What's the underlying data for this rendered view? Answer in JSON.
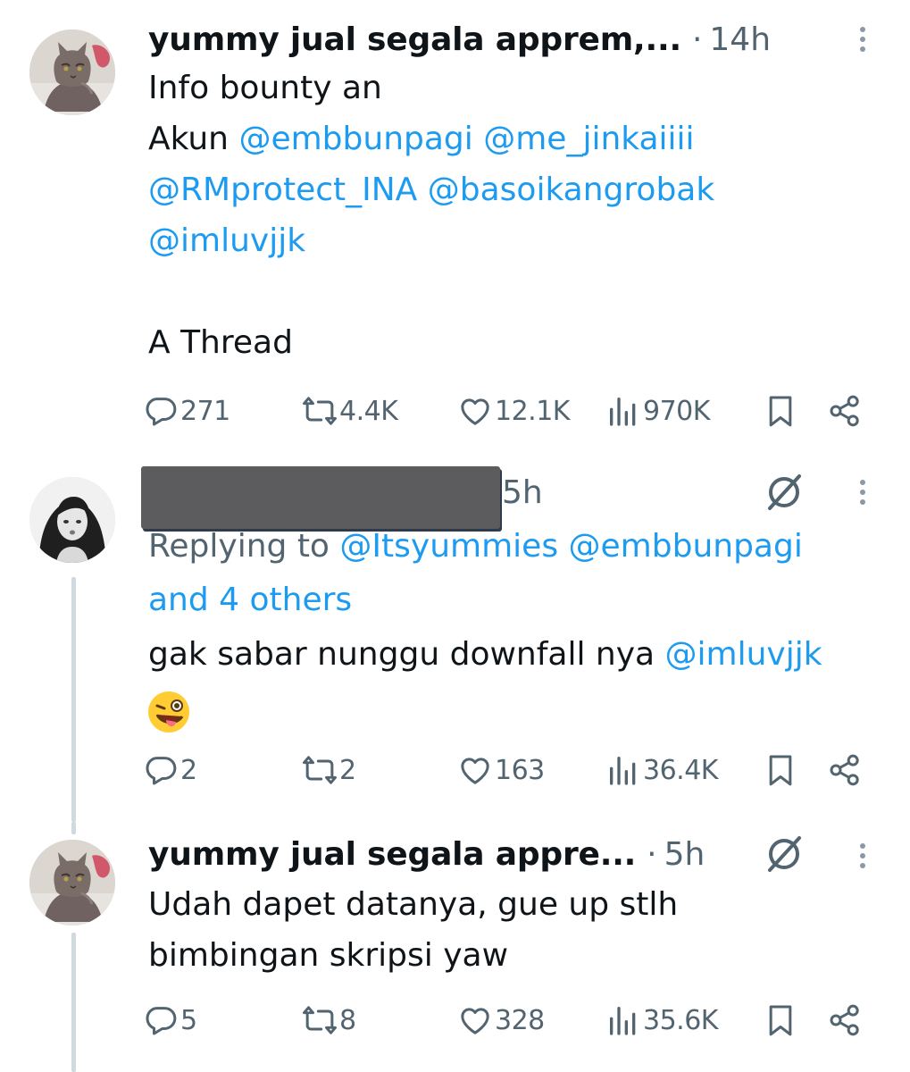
{
  "tweets": [
    {
      "author": "yummy jual segala apprem,...",
      "separator": "·",
      "time": "14h",
      "body_line1": "Info bounty an",
      "body_akun": "Akun",
      "mentions_line2": [
        "@embbunpagi",
        "@me_jinkaiiii"
      ],
      "mentions_line3": [
        "@RMprotect_INA",
        "@basoikangrobak"
      ],
      "mentions_line4": [
        "@imluvjjk"
      ],
      "body_last": "A Thread",
      "stats": {
        "replies": "271",
        "retweets": "4.4K",
        "likes": "12.1K",
        "views": "970K"
      }
    },
    {
      "time": "5h",
      "replying_prefix": "Replying to",
      "replying_mentions": [
        "@Itsyummies",
        "@embbunpagi"
      ],
      "replying_others": "and 4 others",
      "body_text": "gak sabar nunggu downfall nya",
      "body_mention": "@imluvjjk",
      "emoji": "winking-face-with-tongue",
      "stats": {
        "replies": "2",
        "retweets": "2",
        "likes": "163",
        "views": "36.4K"
      }
    },
    {
      "author": "yummy jual segala appre...",
      "separator": "·",
      "time": "5h",
      "body_line1": "Udah dapet datanya, gue up stlh",
      "body_line2": "bimbingan skripsi yaw",
      "stats": {
        "replies": "5",
        "retweets": "8",
        "likes": "328",
        "views": "35.6K"
      }
    }
  ],
  "icons": {
    "reply": "reply-icon",
    "retweet": "retweet-icon",
    "like": "heart-icon",
    "views": "views-icon",
    "bookmark": "bookmark-icon",
    "share": "share-icon",
    "more": "more-vertical-icon",
    "muted": "muted-icon"
  },
  "colors": {
    "mention": "#1d9bf0",
    "muted_text": "#536471",
    "thread_line": "#cfd9de",
    "redaction": "#5c5c5e"
  }
}
